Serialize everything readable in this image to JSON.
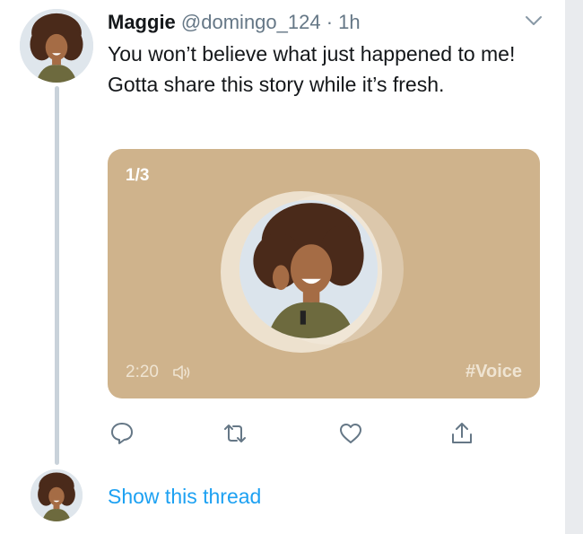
{
  "tweet": {
    "author_name": "Maggie",
    "handle": "@domingo_124",
    "separator": "·",
    "time": "1h",
    "text": "You won’t believe what just happened to me! Gotta share this story while it’s fresh."
  },
  "voice_card": {
    "counter": "1/3",
    "duration": "2:20",
    "hashtag": "#Voice",
    "background_color": "#cfb38c"
  },
  "actions": {
    "icons": [
      "reply-icon",
      "retweet-icon",
      "like-icon",
      "share-icon"
    ]
  },
  "thread": {
    "show_label": "Show this thread",
    "link_color": "#1da1f2"
  }
}
